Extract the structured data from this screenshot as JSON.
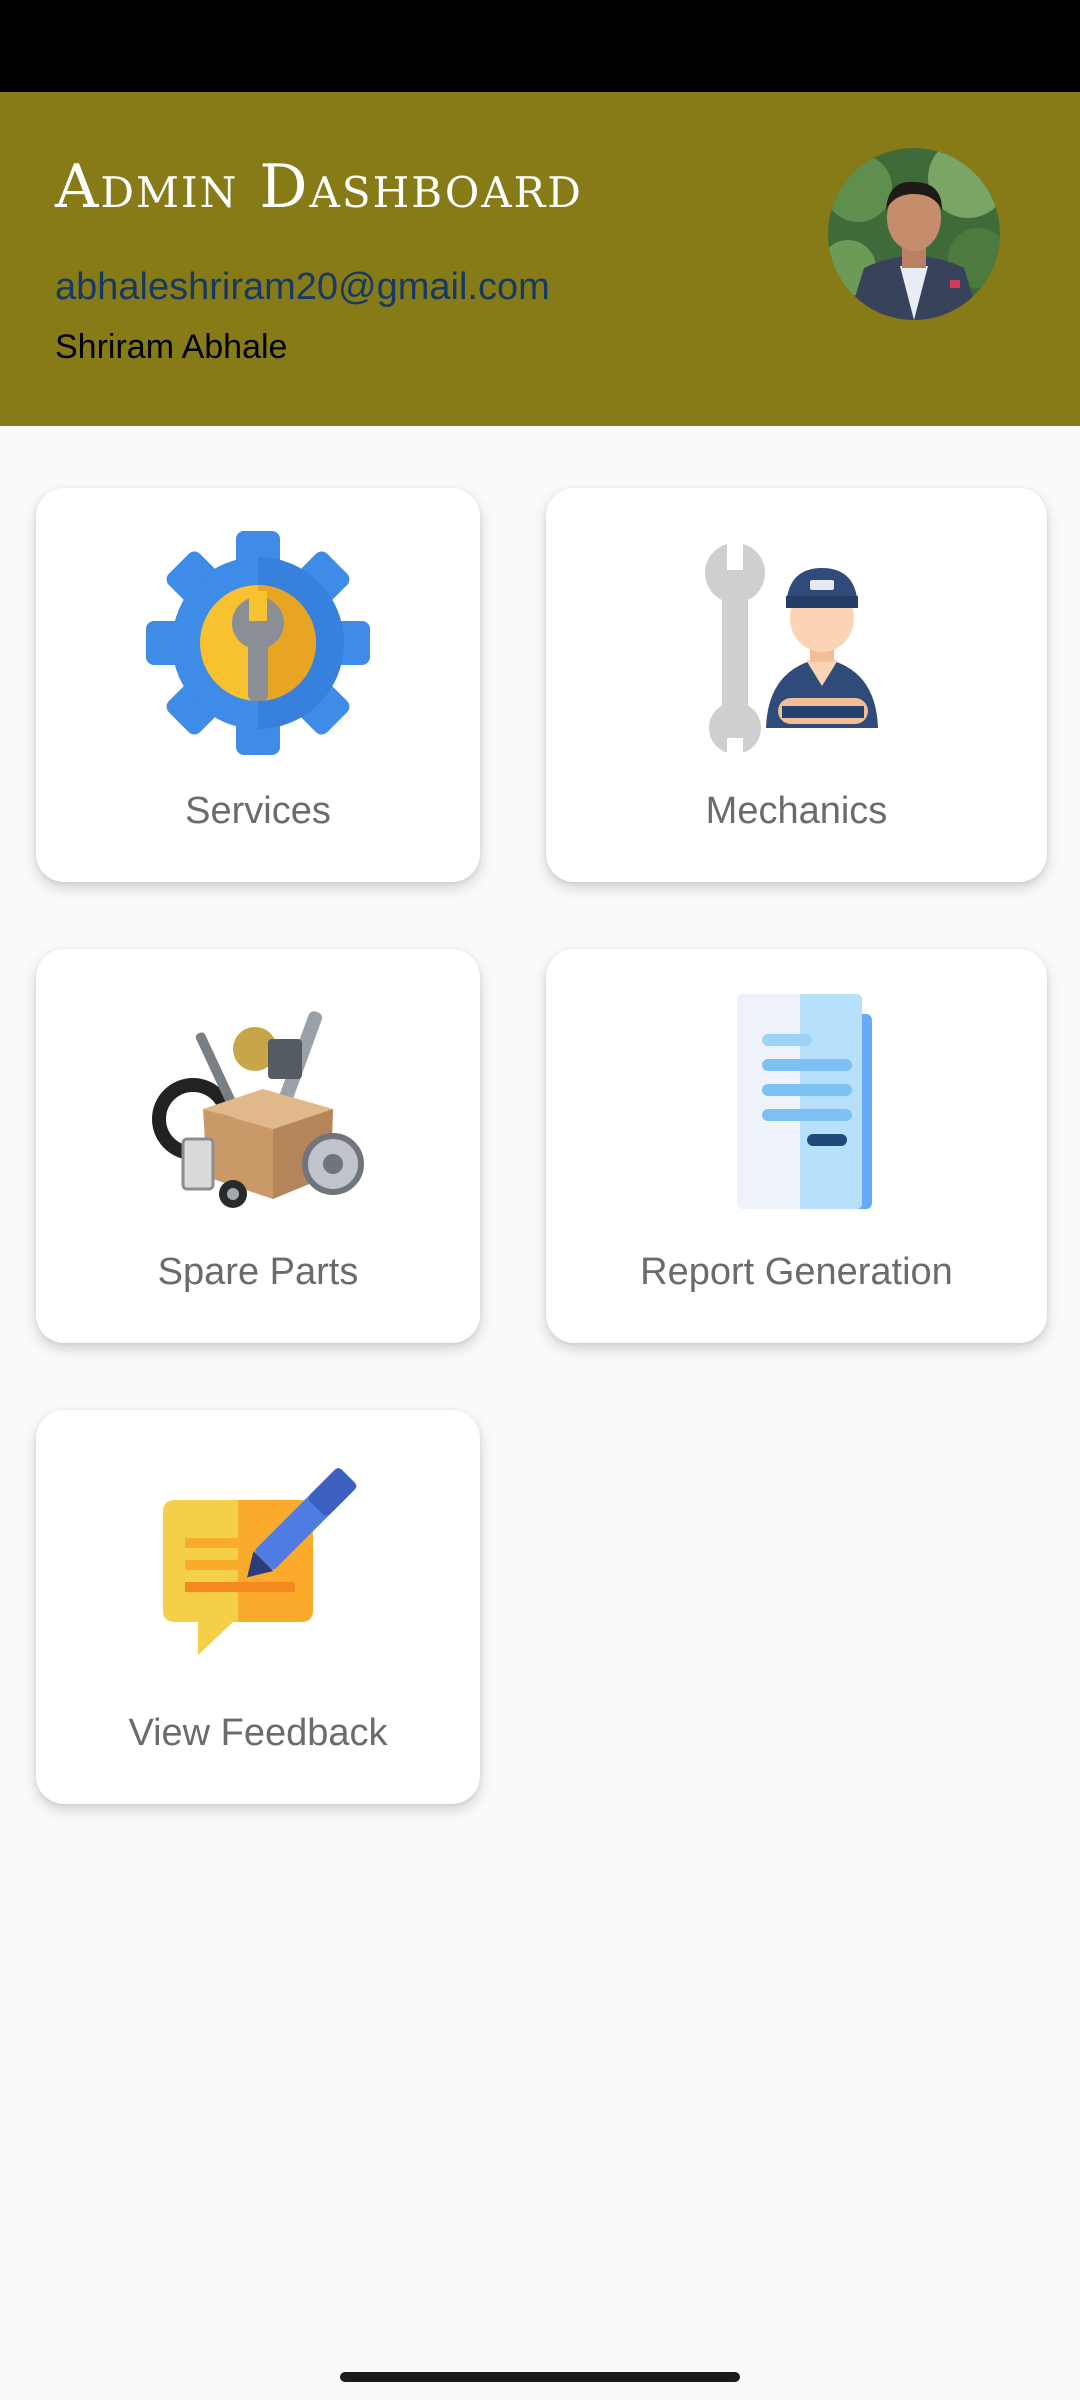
{
  "header": {
    "title": "Admin Dashboard",
    "email": "abhaleshriram20@gmail.com",
    "name": "Shriram Abhale",
    "background_color": "#877b17",
    "email_color": "#163a66"
  },
  "avatar": {
    "icon": "profile-photo"
  },
  "cards": [
    {
      "label": "Services",
      "icon": "gear-wrench-icon"
    },
    {
      "label": "Mechanics",
      "icon": "mechanic-icon"
    },
    {
      "label": "Spare Parts",
      "icon": "spare-parts-box-icon"
    },
    {
      "label": "Report Generation",
      "icon": "report-document-icon"
    },
    {
      "label": "View Feedback",
      "icon": "feedback-pencil-icon"
    }
  ],
  "colors": {
    "background": "#fafafa",
    "card": "#ffffff",
    "label": "#6b6b6b",
    "status_bar": "#000000"
  }
}
